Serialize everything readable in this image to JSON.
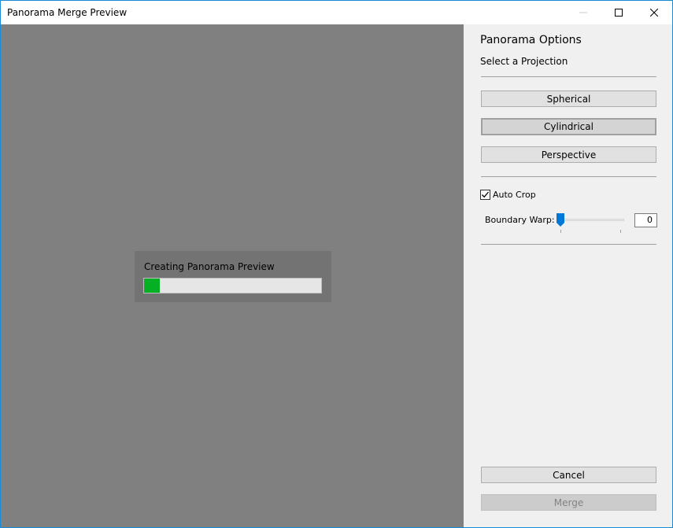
{
  "window": {
    "title": "Panorama Merge Preview"
  },
  "preview": {
    "status_label": "Creating Panorama Preview",
    "progress_fraction": 0.09,
    "progress_color": "#06b025"
  },
  "panel": {
    "title": "Panorama Options",
    "projection_label": "Select a Projection",
    "projections": {
      "spherical": "Spherical",
      "cylindrical": "Cylindrical",
      "perspective": "Perspective"
    },
    "selected_projection": "Cylindrical",
    "auto_crop": {
      "label": "Auto Crop",
      "checked": true
    },
    "boundary_warp": {
      "label": "Boundary Warp:",
      "value": "0"
    },
    "cancel_label": "Cancel",
    "merge_label": "Merge"
  },
  "colors": {
    "accent": "#0078d7",
    "window_border": "#1a8ad4",
    "preview_bg": "#808080",
    "panel_bg": "#f0f0f0"
  }
}
